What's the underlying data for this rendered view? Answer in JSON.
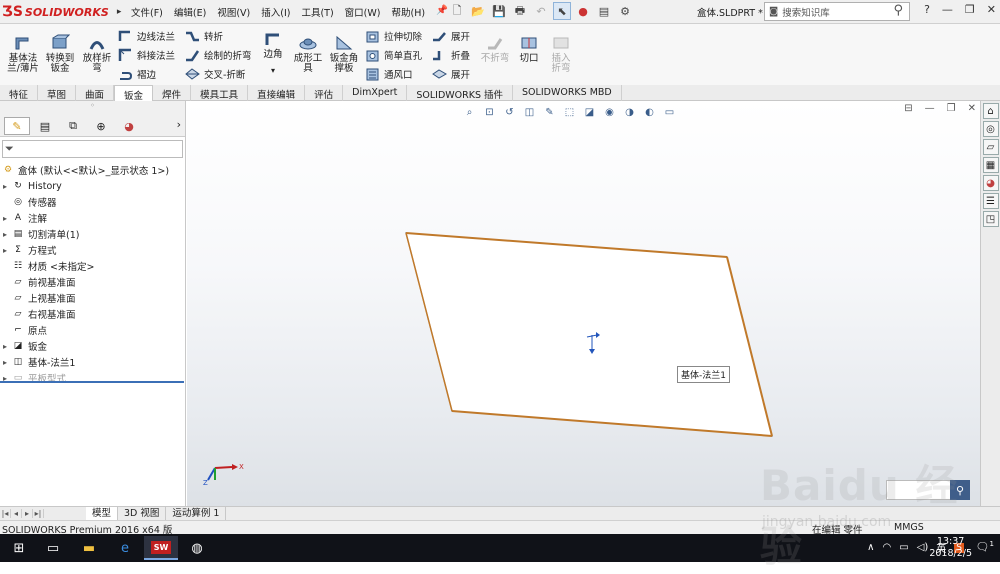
{
  "app": {
    "brand": "SOLIDWORKS",
    "document_name": "盒体.SLDPRT *",
    "search_placeholder": "搜索知识库",
    "help_label": "?"
  },
  "menu": [
    "文件(F)",
    "编辑(E)",
    "视图(V)",
    "插入(I)",
    "工具(T)",
    "窗口(W)",
    "帮助(H)"
  ],
  "ribbon": {
    "base_flange": "基体法兰/薄片",
    "convert_to_sheet_metal": "转换到钣金",
    "lofted_bend": "放样折弯",
    "edge_flange": "边线法兰",
    "miter_flange": "斜接法兰",
    "hem": "褶边",
    "jog": "转折",
    "sketched_bend": "绘制的折弯",
    "cross_break": "交叉-折断",
    "corners": "边角",
    "forming_tool": "成形工具",
    "sheet_metal_gusset": "钣金角撑板",
    "extruded_cut": "拉伸切除",
    "simple_hole": "简单直孔",
    "vent": "通风口",
    "unfold": "展开",
    "fold": "折叠",
    "flatten": "展开",
    "no_bends": "不折弯",
    "cut": "切口",
    "insert_bends": "插入折弯"
  },
  "tabs": [
    "特征",
    "草图",
    "曲面",
    "钣金",
    "焊件",
    "模具工具",
    "直接编辑",
    "评估",
    "DimXpert",
    "SOLIDWORKS 插件",
    "SOLIDWORKS MBD"
  ],
  "active_tab": "钣金",
  "feature_tree": {
    "root": "盒体  (默认<<默认>_显示状态 1>)",
    "items": [
      {
        "label": "History",
        "expandable": true,
        "icon": "history-icon"
      },
      {
        "label": "传感器",
        "expandable": false,
        "icon": "sensor-icon"
      },
      {
        "label": "注解",
        "expandable": true,
        "icon": "annotation-icon"
      },
      {
        "label": "切割清单(1)",
        "expandable": true,
        "icon": "cut-list-icon"
      },
      {
        "label": "方程式",
        "expandable": true,
        "icon": "equation-icon"
      },
      {
        "label": "材质 <未指定>",
        "expandable": false,
        "icon": "material-icon"
      },
      {
        "label": "前视基准面",
        "expandable": false,
        "icon": "plane-icon"
      },
      {
        "label": "上视基准面",
        "expandable": false,
        "icon": "plane-icon"
      },
      {
        "label": "右视基准面",
        "expandable": false,
        "icon": "plane-icon"
      },
      {
        "label": "原点",
        "expandable": false,
        "icon": "origin-icon"
      },
      {
        "label": "钣金",
        "expandable": true,
        "icon": "sheet-metal-icon"
      },
      {
        "label": "基体-法兰1",
        "expandable": true,
        "icon": "base-flange-icon"
      },
      {
        "label": "平板型式",
        "expandable": true,
        "icon": "flat-pattern-icon",
        "suppressed": true
      }
    ]
  },
  "viewport": {
    "tooltip": "基体-法兰1"
  },
  "bottom_tabs": [
    "模型",
    "3D 视图",
    "运动算例 1"
  ],
  "status": {
    "left": "SOLIDWORKS Premium 2016 x64 版",
    "mid": "在编辑 零件",
    "mid2": "MMGS"
  },
  "taskbar": {
    "ime": "英",
    "time": "13:37",
    "date": "2018/2/5",
    "notifications": "1"
  },
  "watermark": {
    "main": "Baidu 经验",
    "sub": "jingyan.baidu.com"
  },
  "colors": {
    "brand_red": "#d02020",
    "flange_edge": "#c0792a",
    "taskbar": "#101218",
    "tree_selection": "#3b6fb6"
  }
}
